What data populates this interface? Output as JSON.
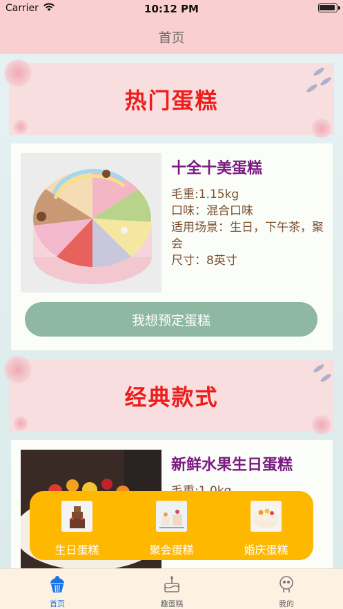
{
  "status_bar": {
    "carrier": "Carrier",
    "time": "10:12 PM"
  },
  "nav": {
    "title": "首页"
  },
  "hot_section": {
    "title": "热门蛋糕"
  },
  "hot_cake": {
    "name": "十全十美蛋糕",
    "weight": "毛重:1.15kg",
    "flavor": "口味：混合口味",
    "occasion": "适用场景：生日，下午茶，聚会",
    "size": "尺寸：8英寸",
    "button_label": "我想预定蛋糕"
  },
  "classic_section": {
    "title": "经典款式"
  },
  "classic_cake": {
    "name": "新鲜水果生日蛋糕",
    "weight": "毛重:1.0kg"
  },
  "categories": [
    {
      "label": "生日蛋糕"
    },
    {
      "label": "聚会蛋糕"
    },
    {
      "label": "婚庆蛋糕"
    }
  ],
  "tabs": [
    {
      "label": "首页",
      "icon": "cupcake-icon",
      "active": true
    },
    {
      "label": "趣蛋糕",
      "icon": "cake-icon",
      "active": false
    },
    {
      "label": "我的",
      "icon": "profile-icon",
      "active": false
    }
  ],
  "colors": {
    "nav_bg": "#f9cfcf",
    "banner_title": "#ee1c1c",
    "cake_name": "#7a1a82",
    "info_text": "#7b4e30",
    "button_bg": "#8fb8a3",
    "category_panel": "#ffb800",
    "tab_active": "#1a73e8"
  }
}
